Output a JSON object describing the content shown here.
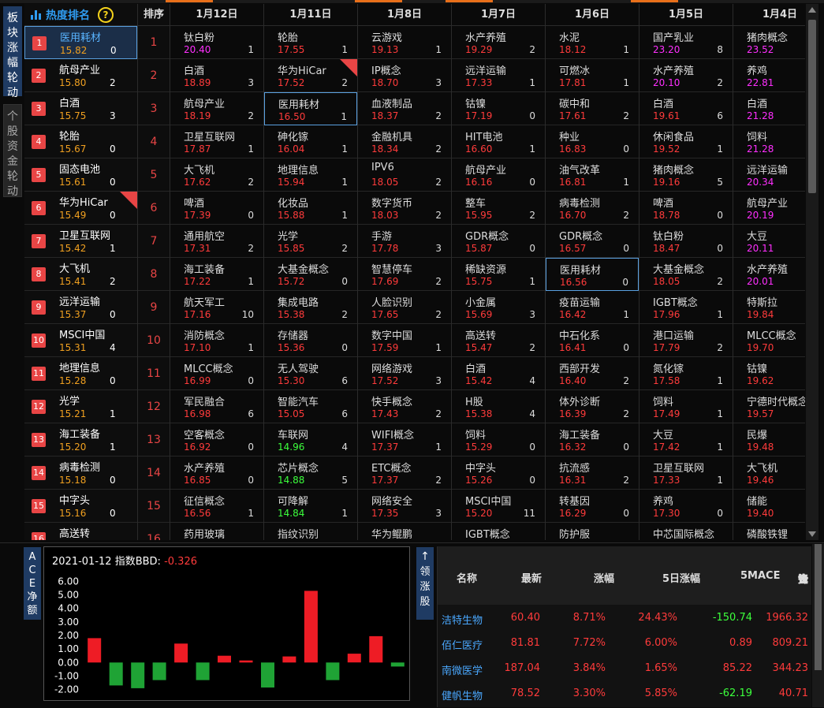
{
  "tabs": {
    "sector_rotation": "板块涨幅轮动",
    "stock_fund_rotation": "个股资金轮动"
  },
  "rank_panel": {
    "title": "热度排名",
    "help_icon": "?",
    "order_header": "排序",
    "items": [
      {
        "rank": "1",
        "name": "医用耗材",
        "value": "15.82",
        "count": "0",
        "selected": true,
        "new": false
      },
      {
        "rank": "2",
        "name": "航母产业",
        "value": "15.80",
        "count": "2",
        "selected": false,
        "new": false
      },
      {
        "rank": "3",
        "name": "白酒",
        "value": "15.75",
        "count": "3",
        "selected": false,
        "new": false
      },
      {
        "rank": "4",
        "name": "轮胎",
        "value": "15.67",
        "count": "0",
        "selected": false,
        "new": false
      },
      {
        "rank": "5",
        "name": "固态电池",
        "value": "15.61",
        "count": "0",
        "selected": false,
        "new": false
      },
      {
        "rank": "6",
        "name": "华为HiCar",
        "value": "15.49",
        "count": "0",
        "selected": false,
        "new": true
      },
      {
        "rank": "7",
        "name": "卫星互联网",
        "value": "15.42",
        "count": "1",
        "selected": false,
        "new": false
      },
      {
        "rank": "8",
        "name": "大飞机",
        "value": "15.41",
        "count": "2",
        "selected": false,
        "new": false
      },
      {
        "rank": "9",
        "name": "远洋运输",
        "value": "15.37",
        "count": "0",
        "selected": false,
        "new": false
      },
      {
        "rank": "10",
        "name": "MSCI中国",
        "value": "15.31",
        "count": "4",
        "selected": false,
        "new": false
      },
      {
        "rank": "11",
        "name": "地理信息",
        "value": "15.28",
        "count": "0",
        "selected": false,
        "new": false
      },
      {
        "rank": "12",
        "name": "光学",
        "value": "15.21",
        "count": "1",
        "selected": false,
        "new": false
      },
      {
        "rank": "13",
        "name": "海工装备",
        "value": "15.20",
        "count": "1",
        "selected": false,
        "new": false
      },
      {
        "rank": "14",
        "name": "病毒检测",
        "value": "15.18",
        "count": "0",
        "selected": false,
        "new": false
      },
      {
        "rank": "15",
        "name": "中字头",
        "value": "15.16",
        "count": "0",
        "selected": false,
        "new": false
      },
      {
        "rank": "16",
        "name": "高送转",
        "value": "",
        "count": "",
        "selected": false,
        "new": false
      }
    ],
    "new_tag": "New"
  },
  "grid": {
    "columns": [
      {
        "date": "1月12日",
        "cells": [
          [
            "钛白粉",
            "20.40",
            "1",
            "pink"
          ],
          [
            "白酒",
            "18.89",
            "3",
            "red"
          ],
          [
            "航母产业",
            "18.19",
            "2",
            "red"
          ],
          [
            "卫星互联网",
            "17.87",
            "1",
            "red"
          ],
          [
            "大飞机",
            "17.62",
            "2",
            "red"
          ],
          [
            "啤酒",
            "17.39",
            "0",
            "red"
          ],
          [
            "通用航空",
            "17.31",
            "2",
            "red"
          ],
          [
            "海工装备",
            "17.22",
            "1",
            "red"
          ],
          [
            "航天军工",
            "17.16",
            "10",
            "red"
          ],
          [
            "消防概念",
            "17.10",
            "1",
            "red"
          ],
          [
            "MLCC概念",
            "16.99",
            "0",
            "red"
          ],
          [
            "军民融合",
            "16.98",
            "6",
            "red"
          ],
          [
            "空客概念",
            "16.92",
            "0",
            "red"
          ],
          [
            "水产养殖",
            "16.85",
            "0",
            "red"
          ],
          [
            "征信概念",
            "16.56",
            "1",
            "red"
          ],
          [
            "药用玻璃",
            "",
            "",
            ""
          ]
        ]
      },
      {
        "date": "1月11日",
        "cells": [
          [
            "轮胎",
            "17.55",
            "1",
            "red"
          ],
          [
            "华为HiCar",
            "17.52",
            "2",
            "red"
          ],
          [
            "医用耗材",
            "16.50",
            "1",
            "red"
          ],
          [
            "砷化镓",
            "16.04",
            "1",
            "red"
          ],
          [
            "地理信息",
            "15.94",
            "1",
            "red"
          ],
          [
            "化妆品",
            "15.88",
            "1",
            "red"
          ],
          [
            "光学",
            "15.85",
            "2",
            "red"
          ],
          [
            "大基金概念",
            "15.72",
            "0",
            "red"
          ],
          [
            "集成电路",
            "15.38",
            "2",
            "red"
          ],
          [
            "存储器",
            "15.36",
            "0",
            "red"
          ],
          [
            "无人驾驶",
            "15.30",
            "6",
            "red"
          ],
          [
            "智能汽车",
            "15.05",
            "6",
            "red"
          ],
          [
            "车联网",
            "14.96",
            "4",
            "grn"
          ],
          [
            "芯片概念",
            "14.88",
            "5",
            "grn"
          ],
          [
            "可降解",
            "14.84",
            "1",
            "grn"
          ],
          [
            "指纹识别",
            "",
            "",
            ""
          ]
        ]
      },
      {
        "date": "1月8日",
        "cells": [
          [
            "云游戏",
            "19.13",
            "1",
            "red"
          ],
          [
            "IP概念",
            "18.70",
            "3",
            "red"
          ],
          [
            "血液制品",
            "18.37",
            "2",
            "red"
          ],
          [
            "金融机具",
            "18.34",
            "2",
            "red"
          ],
          [
            "IPV6",
            "18.05",
            "2",
            "red"
          ],
          [
            "数字货币",
            "18.03",
            "2",
            "red"
          ],
          [
            "手游",
            "17.78",
            "3",
            "red"
          ],
          [
            "智慧停车",
            "17.69",
            "2",
            "red"
          ],
          [
            "人脸识别",
            "17.65",
            "2",
            "red"
          ],
          [
            "数字中国",
            "17.59",
            "1",
            "red"
          ],
          [
            "网络游戏",
            "17.52",
            "3",
            "red"
          ],
          [
            "快手概念",
            "17.43",
            "2",
            "red"
          ],
          [
            "WIFI概念",
            "17.37",
            "1",
            "red"
          ],
          [
            "ETC概念",
            "17.37",
            "2",
            "red"
          ],
          [
            "网络安全",
            "17.35",
            "3",
            "red"
          ],
          [
            "华为鲲鹏",
            "",
            "",
            ""
          ]
        ]
      },
      {
        "date": "1月7日",
        "cells": [
          [
            "水产养殖",
            "19.29",
            "2",
            "red"
          ],
          [
            "远洋运输",
            "17.33",
            "1",
            "red"
          ],
          [
            "钴镍",
            "17.19",
            "0",
            "red"
          ],
          [
            "HIT电池",
            "16.60",
            "1",
            "red"
          ],
          [
            "航母产业",
            "16.16",
            "0",
            "red"
          ],
          [
            "整车",
            "15.95",
            "2",
            "red"
          ],
          [
            "GDR概念",
            "15.87",
            "0",
            "red"
          ],
          [
            "稀缺资源",
            "15.75",
            "1",
            "red"
          ],
          [
            "小金属",
            "15.69",
            "3",
            "red"
          ],
          [
            "高送转",
            "15.47",
            "2",
            "red"
          ],
          [
            "白酒",
            "15.42",
            "4",
            "red"
          ],
          [
            "H股",
            "15.38",
            "4",
            "red"
          ],
          [
            "饲料",
            "15.29",
            "0",
            "red"
          ],
          [
            "中字头",
            "15.26",
            "0",
            "red"
          ],
          [
            "MSCI中国",
            "15.20",
            "11",
            "red"
          ],
          [
            "IGBT概念",
            "",
            "",
            ""
          ]
        ]
      },
      {
        "date": "1月6日",
        "cells": [
          [
            "水泥",
            "18.12",
            "1",
            "red"
          ],
          [
            "可燃冰",
            "17.81",
            "1",
            "red"
          ],
          [
            "碳中和",
            "17.61",
            "2",
            "red"
          ],
          [
            "种业",
            "16.83",
            "0",
            "red"
          ],
          [
            "油气改革",
            "16.81",
            "1",
            "red"
          ],
          [
            "病毒检测",
            "16.70",
            "2",
            "red"
          ],
          [
            "GDR概念",
            "16.57",
            "0",
            "red"
          ],
          [
            "医用耗材",
            "16.56",
            "0",
            "red"
          ],
          [
            "疫苗运输",
            "16.42",
            "1",
            "red"
          ],
          [
            "中石化系",
            "16.41",
            "0",
            "red"
          ],
          [
            "西部开发",
            "16.40",
            "2",
            "red"
          ],
          [
            "体外诊断",
            "16.39",
            "2",
            "red"
          ],
          [
            "海工装备",
            "16.32",
            "0",
            "red"
          ],
          [
            "抗流感",
            "16.31",
            "2",
            "red"
          ],
          [
            "转基因",
            "16.29",
            "0",
            "red"
          ],
          [
            "防护服",
            "",
            "",
            ""
          ]
        ]
      },
      {
        "date": "1月5日",
        "cells": [
          [
            "国产乳业",
            "23.20",
            "8",
            "pink"
          ],
          [
            "水产养殖",
            "20.10",
            "2",
            "pink"
          ],
          [
            "白酒",
            "19.61",
            "6",
            "red"
          ],
          [
            "休闲食品",
            "19.52",
            "1",
            "red"
          ],
          [
            "猪肉概念",
            "19.16",
            "5",
            "red"
          ],
          [
            "啤酒",
            "18.78",
            "0",
            "red"
          ],
          [
            "钛白粉",
            "18.47",
            "0",
            "red"
          ],
          [
            "大基金概念",
            "18.05",
            "2",
            "red"
          ],
          [
            "IGBT概念",
            "17.96",
            "1",
            "red"
          ],
          [
            "港口运输",
            "17.79",
            "2",
            "red"
          ],
          [
            "氮化镓",
            "17.58",
            "1",
            "red"
          ],
          [
            "饲料",
            "17.49",
            "1",
            "red"
          ],
          [
            "大豆",
            "17.42",
            "1",
            "red"
          ],
          [
            "卫星互联网",
            "17.33",
            "1",
            "red"
          ],
          [
            "养鸡",
            "17.30",
            "0",
            "red"
          ],
          [
            "中芯国际概念",
            "",
            "",
            ""
          ]
        ]
      },
      {
        "date": "1月4日",
        "cells": [
          [
            "猪肉概念",
            "23.52",
            "1",
            "pink"
          ],
          [
            "养鸡",
            "22.81",
            "1",
            "pink"
          ],
          [
            "白酒",
            "21.28",
            "9",
            "pink"
          ],
          [
            "饲料",
            "21.28",
            "4",
            "pink"
          ],
          [
            "远洋运输",
            "20.34",
            "2",
            "pink"
          ],
          [
            "航母产业",
            "20.19",
            "5",
            "pink"
          ],
          [
            "大豆",
            "20.11",
            "2",
            "pink"
          ],
          [
            "水产养殖",
            "20.01",
            "1",
            "pink"
          ],
          [
            "特斯拉",
            "19.84",
            "1",
            "red"
          ],
          [
            "MLCC概念",
            "19.70",
            "2",
            "red"
          ],
          [
            "钴镍",
            "19.62",
            "1",
            "red"
          ],
          [
            "宁德时代概念",
            "19.57",
            "7",
            "red"
          ],
          [
            "民爆",
            "19.48",
            "2",
            "red"
          ],
          [
            "大飞机",
            "19.46",
            "6",
            "red"
          ],
          [
            "储能",
            "19.40",
            "7",
            "red"
          ],
          [
            "磷酸铁锂",
            "",
            "",
            ""
          ]
        ]
      }
    ]
  },
  "ace_tab": "ACE净额",
  "bbd_chart": {
    "date": "2021-01-12",
    "label": "指数BBD:",
    "value": "-0.326"
  },
  "chart_data": {
    "type": "bar",
    "title": "2021-01-12 指数BBD: -0.326",
    "categories": [
      "1",
      "2",
      "3",
      "4",
      "5",
      "6",
      "7",
      "8",
      "9",
      "10",
      "11",
      "12",
      "13",
      "14",
      "15"
    ],
    "values": [
      1.8,
      -1.7,
      -1.9,
      -1.3,
      1.4,
      -1.3,
      0.5,
      0.15,
      -1.85,
      0.45,
      5.3,
      -1.3,
      0.65,
      1.95,
      -0.3
    ],
    "ylim": [
      -2.2,
      6.2
    ],
    "yticks": [
      "6.00",
      "5.00",
      "4.00",
      "3.00",
      "2.00",
      "1.00",
      "0.00",
      "-1.00",
      "-2.00"
    ],
    "ytick_values": [
      6,
      5,
      4,
      3,
      2,
      1,
      0,
      -1,
      -2
    ],
    "grid": false,
    "colors": {
      "positive": "#ee1c25",
      "negative": "#1fa335"
    }
  },
  "leading_tab": {
    "arrow": "↑",
    "label": "领涨股"
  },
  "stock_table": {
    "headers": {
      "name": "名称",
      "latest": "最新",
      "change": "涨幅",
      "change5": "5日涨幅",
      "mace": "5MACE",
      "fund": "资金先锋"
    },
    "rows": [
      {
        "name": "洁特生物",
        "latest": "60.40",
        "change": "8.71%",
        "change5": "24.43%",
        "mace": "-150.74",
        "fund": "1966.32",
        "mace_color": "#3cff3c"
      },
      {
        "name": "佰仁医疗",
        "latest": "81.81",
        "change": "7.72%",
        "change5": "6.00%",
        "mace": "0.89",
        "fund": "809.21",
        "mace_color": "#ff3b3b"
      },
      {
        "name": "南微医学",
        "latest": "187.04",
        "change": "3.84%",
        "change5": "1.65%",
        "mace": "85.22",
        "fund": "344.23",
        "mace_color": "#ff3b3b"
      },
      {
        "name": "健帆生物",
        "latest": "78.52",
        "change": "3.30%",
        "change5": "5.85%",
        "mace": "-62.19",
        "fund": "40.71",
        "mace_color": "#3cff3c"
      }
    ]
  }
}
